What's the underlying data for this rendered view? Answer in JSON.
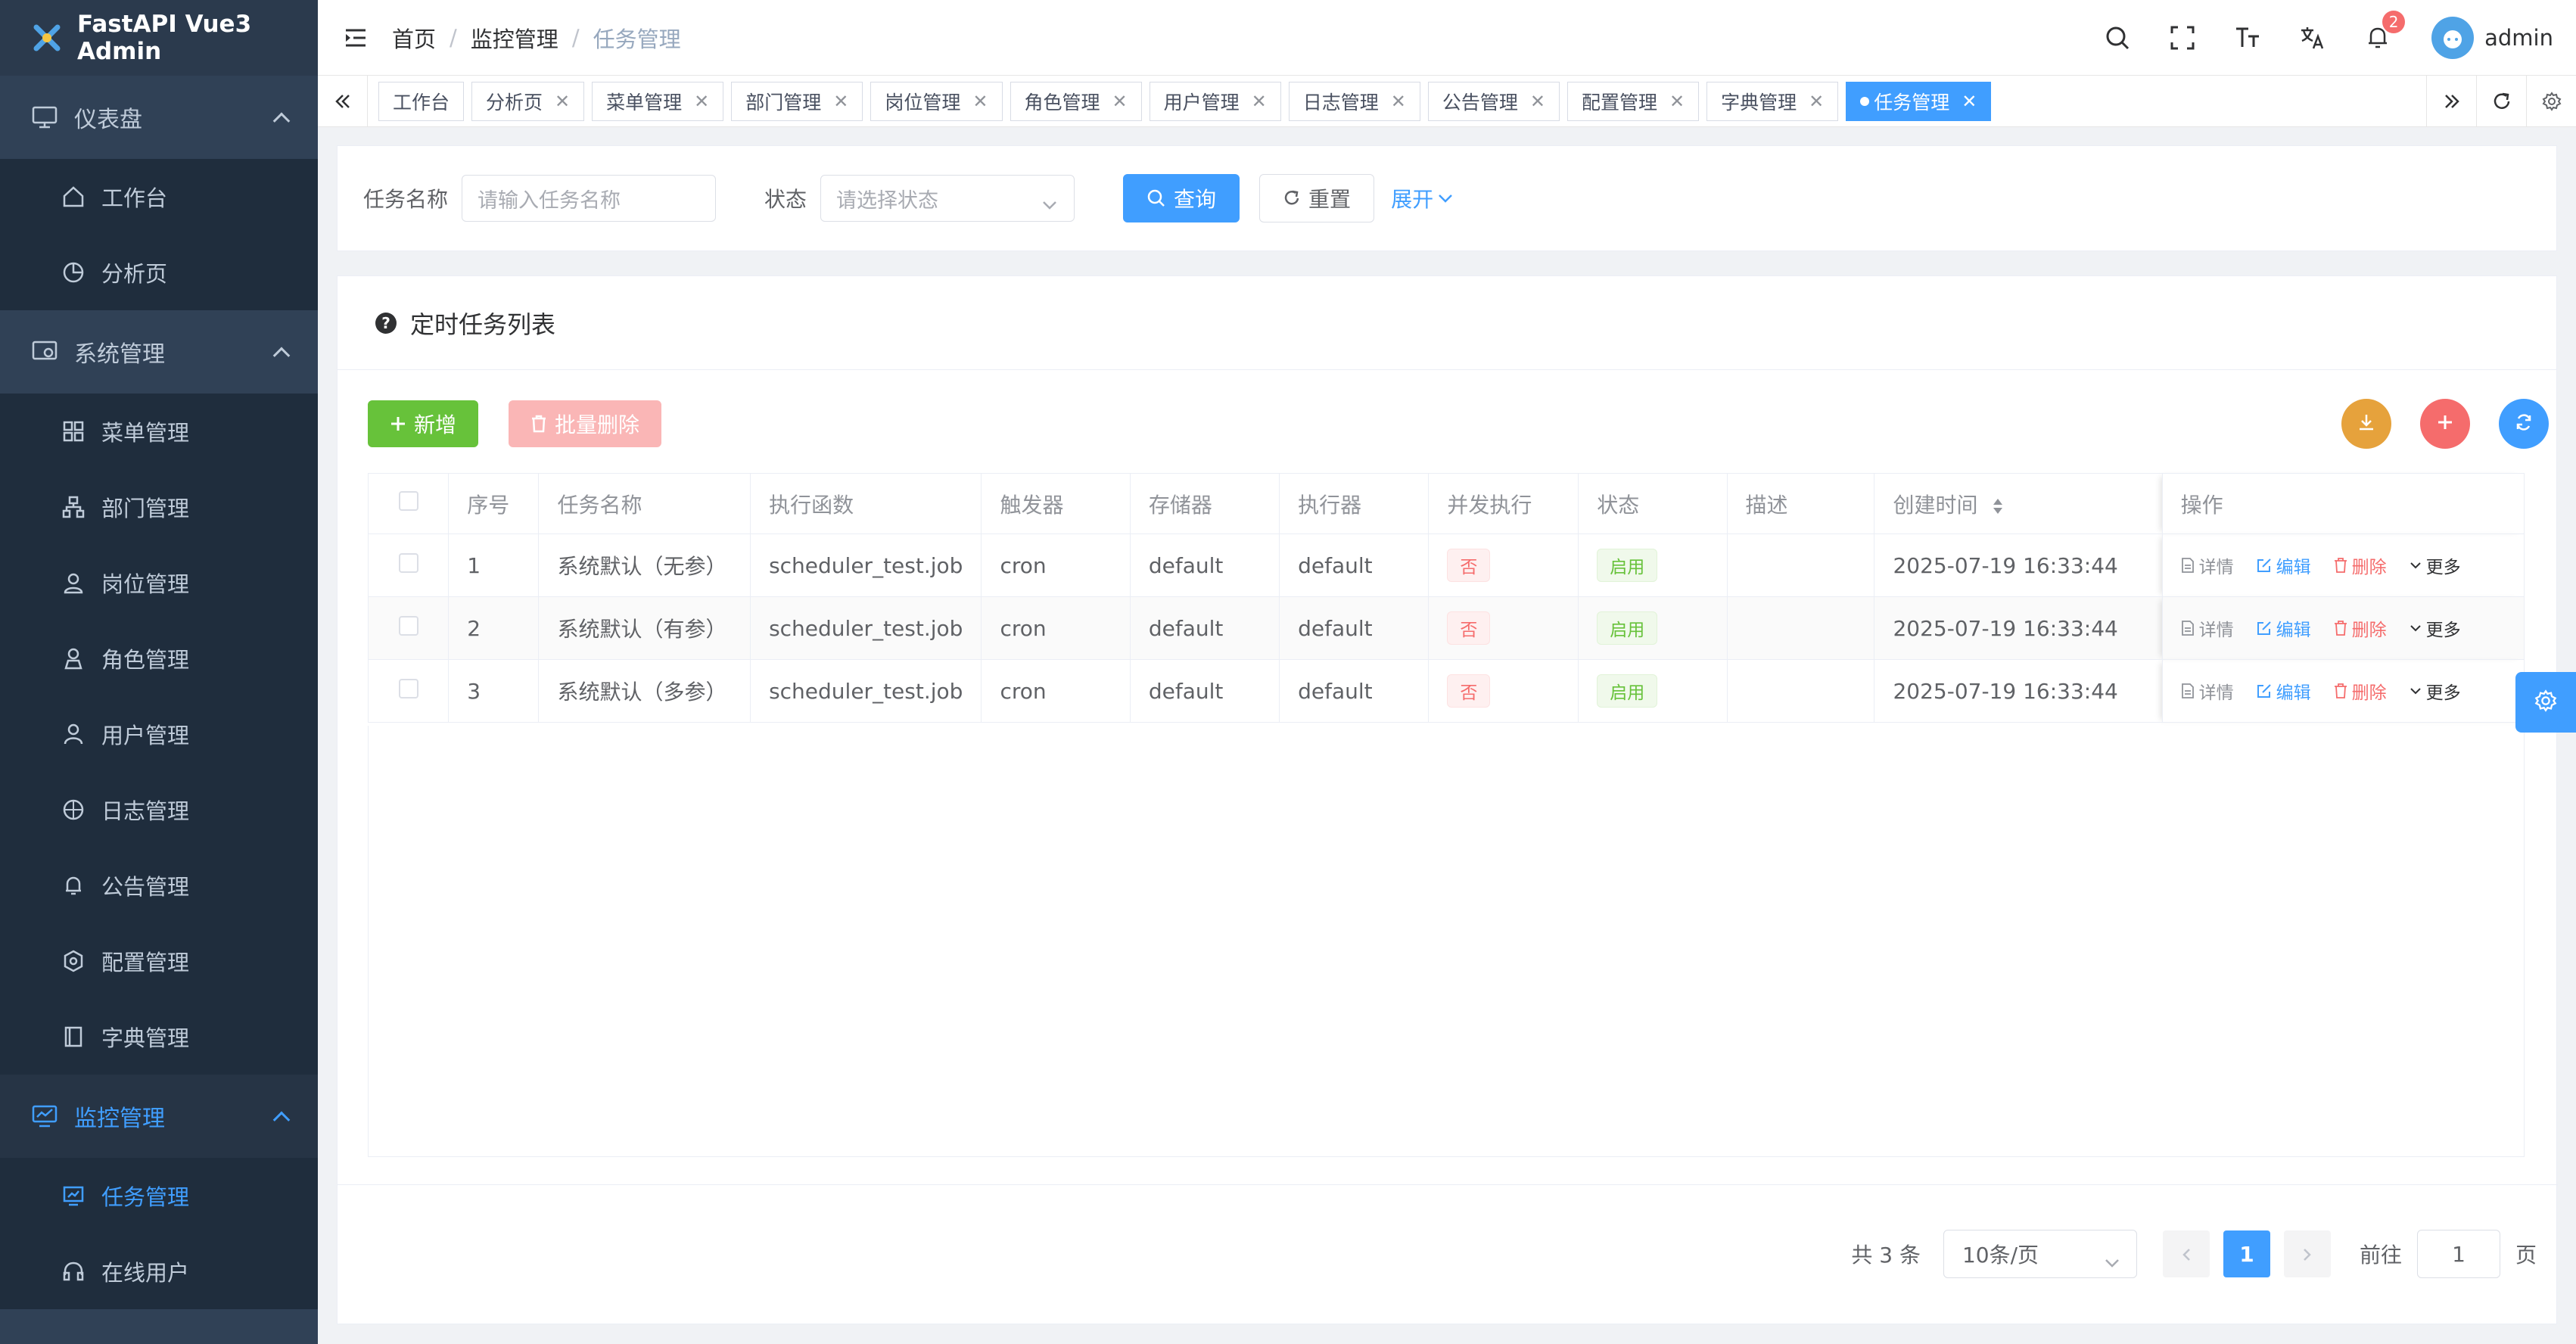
{
  "app": {
    "title": "FastAPI Vue3 Admin"
  },
  "sidebar": {
    "groups": [
      {
        "label": "仪表盘",
        "items": [
          {
            "label": "工作台"
          },
          {
            "label": "分析页"
          }
        ]
      },
      {
        "label": "系统管理",
        "items": [
          {
            "label": "菜单管理"
          },
          {
            "label": "部门管理"
          },
          {
            "label": "岗位管理"
          },
          {
            "label": "角色管理"
          },
          {
            "label": "用户管理"
          },
          {
            "label": "日志管理"
          },
          {
            "label": "公告管理"
          },
          {
            "label": "配置管理"
          },
          {
            "label": "字典管理"
          }
        ]
      },
      {
        "label": "监控管理",
        "items": [
          {
            "label": "任务管理"
          },
          {
            "label": "在线用户"
          }
        ]
      }
    ]
  },
  "header": {
    "breadcrumb": [
      "首页",
      "监控管理",
      "任务管理"
    ],
    "separator": "/",
    "notification_count": "2",
    "username": "admin"
  },
  "tags": [
    "工作台",
    "分析页",
    "菜单管理",
    "部门管理",
    "岗位管理",
    "角色管理",
    "用户管理",
    "日志管理",
    "公告管理",
    "配置管理",
    "字典管理",
    "任务管理"
  ],
  "search": {
    "name_label": "任务名称",
    "name_placeholder": "请输入任务名称",
    "status_label": "状态",
    "status_placeholder": "请选择状态",
    "query_label": "查询",
    "reset_label": "重置",
    "expand_label": "展开"
  },
  "table": {
    "title": "定时任务列表",
    "add_label": "新增",
    "batch_delete_label": "批量删除",
    "columns": [
      "序号",
      "任务名称",
      "执行函数",
      "触发器",
      "存储器",
      "执行器",
      "并发执行",
      "状态",
      "描述",
      "创建时间",
      "操作"
    ],
    "rows": [
      {
        "index": "1",
        "name": "系统默认（无参）",
        "func": "scheduler_test.job",
        "trigger": "cron",
        "store": "default",
        "executor": "default",
        "concurrent": "否",
        "status": "启用",
        "desc": "",
        "created": "2025-07-19 16:33:44"
      },
      {
        "index": "2",
        "name": "系统默认（有参）",
        "func": "scheduler_test.job",
        "trigger": "cron",
        "store": "default",
        "executor": "default",
        "concurrent": "否",
        "status": "启用",
        "desc": "",
        "created": "2025-07-19 16:33:44"
      },
      {
        "index": "3",
        "name": "系统默认（多参）",
        "func": "scheduler_test.job",
        "trigger": "cron",
        "store": "default",
        "executor": "default",
        "concurrent": "否",
        "status": "启用",
        "desc": "",
        "created": "2025-07-19 16:33:44"
      }
    ],
    "ops": {
      "detail": "详情",
      "edit": "编辑",
      "delete": "删除",
      "more": "更多"
    }
  },
  "pagination": {
    "total_text": "共 3 条",
    "page_size": "10条/页",
    "current_page": "1",
    "goto_label": "前往",
    "goto_value": "1",
    "page_suffix": "页"
  },
  "colors": {
    "primary": "#409eff",
    "sidebar": "#304156",
    "success": "#67c23a",
    "danger": "#f56c6c",
    "warning": "#e6a23c"
  }
}
